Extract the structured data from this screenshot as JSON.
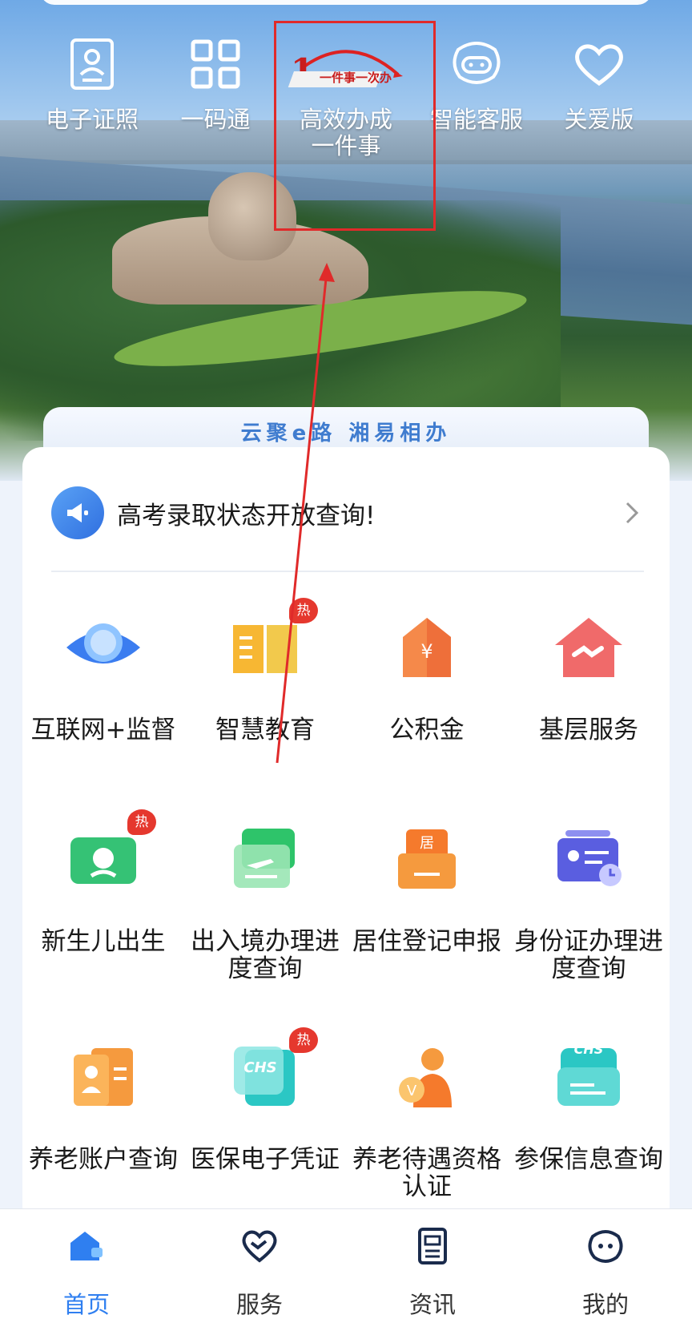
{
  "quick_items": [
    {
      "label": "电子证照",
      "icon": "id-card-icon"
    },
    {
      "label": "一码通",
      "icon": "qr-code-icon"
    },
    {
      "label": "高效办成一件事",
      "icon": "one-thing-logo-icon",
      "logo_text": "一件事一次办"
    },
    {
      "label": "智能客服",
      "icon": "robot-face-icon"
    },
    {
      "label": "关爱版",
      "icon": "heart-icon"
    }
  ],
  "slogan": "云聚e路 湘易相办",
  "notice": {
    "text": "高考录取状态开放查询!",
    "icon": "megaphone-icon"
  },
  "hot_badge": "热",
  "services": [
    {
      "label": "互联网+监督",
      "icon": "eye-icon",
      "hot": false
    },
    {
      "label": "智慧教育",
      "icon": "open-book-icon",
      "hot": true
    },
    {
      "label": "公积金",
      "icon": "yuan-house-icon",
      "hot": false
    },
    {
      "label": "基层服务",
      "icon": "handshake-house-icon",
      "hot": false
    },
    {
      "label": "新生儿出生",
      "icon": "baby-icon",
      "hot": true
    },
    {
      "label": "出入境办理进度查询",
      "icon": "plane-ticket-icon",
      "hot": false
    },
    {
      "label": "居住登记申报",
      "icon": "residence-envelope-icon",
      "hot": false,
      "icon_text": "居"
    },
    {
      "label": "身份证办理进度查询",
      "icon": "id-card-clock-icon",
      "hot": false
    },
    {
      "label": "养老账户查询",
      "icon": "elderly-document-icon",
      "hot": false
    },
    {
      "label": "医保电子凭证",
      "icon": "chs-card-icon",
      "hot": true,
      "icon_text": "CHS"
    },
    {
      "label": "养老待遇资格认证",
      "icon": "elderly-person-icon",
      "hot": false
    },
    {
      "label": "参保信息查询",
      "icon": "chs-envelope-icon",
      "hot": false,
      "icon_text": "CHS"
    }
  ],
  "bottom_nav": [
    {
      "label": "首页",
      "icon": "home-icon",
      "active": true
    },
    {
      "label": "服务",
      "icon": "service-heart-icon",
      "active": false
    },
    {
      "label": "资讯",
      "icon": "news-document-icon",
      "active": false
    },
    {
      "label": "我的",
      "icon": "profile-face-icon",
      "active": false
    }
  ],
  "colors": {
    "accent": "#2f7ff0",
    "annotation": "#e02a2a",
    "hot": "#e5382e"
  }
}
